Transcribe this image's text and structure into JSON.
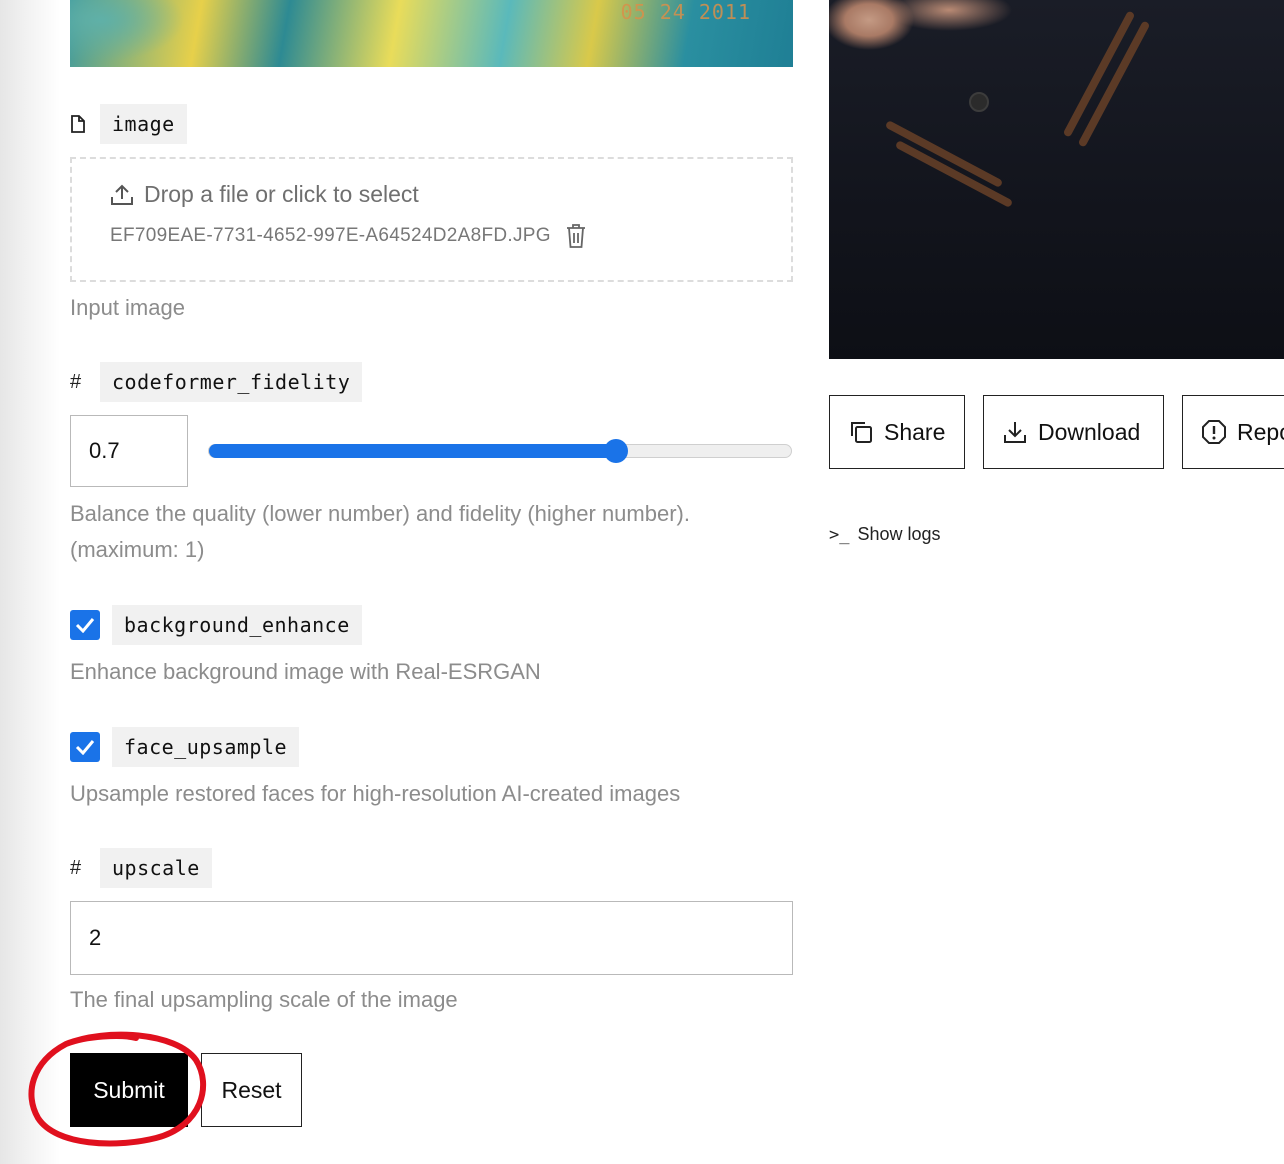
{
  "form": {
    "image": {
      "name": "image",
      "dropzone_label": "Drop a file or click to select",
      "file_name": "EF709EAE-7731-4652-997E-A64524D2A8FD.JPG",
      "help": "Input image"
    },
    "codeformer_fidelity": {
      "name": "codeformer_fidelity",
      "type_symbol": "#",
      "value": "0.7",
      "slider_fraction": 0.7,
      "help": "Balance the quality (lower number) and fidelity (higher number). (maximum: 1)"
    },
    "background_enhance": {
      "name": "background_enhance",
      "checked": true,
      "help": "Enhance background image with Real-ESRGAN"
    },
    "face_upsample": {
      "name": "face_upsample",
      "checked": true,
      "help": "Upsample restored faces for high-resolution AI-created images"
    },
    "upscale": {
      "name": "upscale",
      "type_symbol": "#",
      "value": "2",
      "help": "The final upsampling scale of the image"
    },
    "submit_label": "Submit",
    "reset_label": "Reset"
  },
  "input_preview": {
    "date_stamp": "05 24 2011"
  },
  "output": {
    "share_label": "Share",
    "download_label": "Download",
    "report_label": "Report",
    "show_logs_prompt": ">_",
    "show_logs_label": "Show logs"
  },
  "colors": {
    "accent": "#1a73e8",
    "annotation": "#e0101e"
  }
}
